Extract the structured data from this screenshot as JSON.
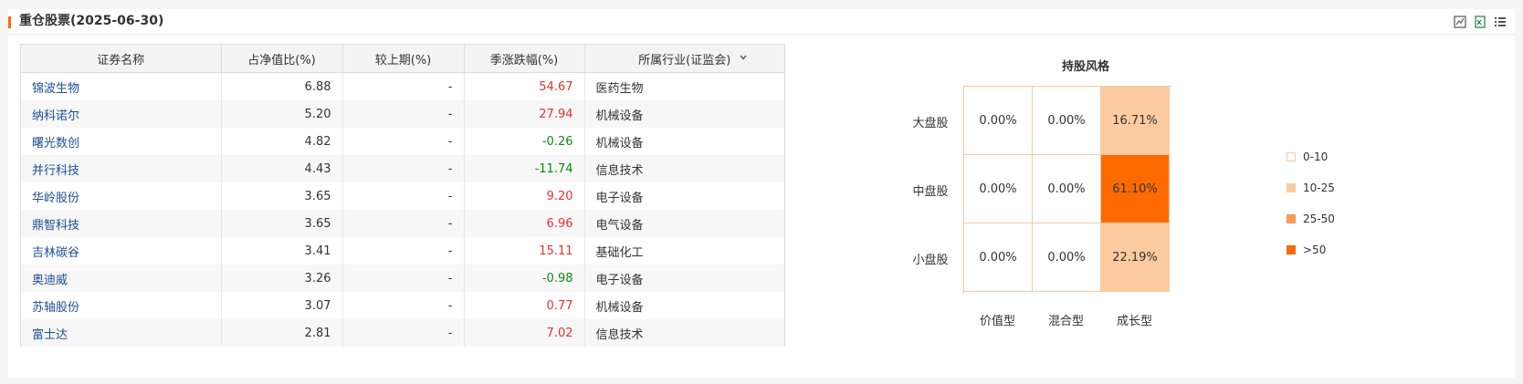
{
  "panel": {
    "title": "重仓股票(2025-06-30)"
  },
  "toolbar": {
    "icons": [
      "chart-export-icon",
      "excel-export-icon",
      "list-view-icon"
    ]
  },
  "table": {
    "columns": [
      "证券名称",
      "占净值比(%)",
      "较上期(%)",
      "季涨跌幅(%)",
      "所属行业(证监会)"
    ],
    "rows": [
      {
        "name": "锦波生物",
        "ratio": "6.88",
        "change": "-",
        "quarter": "54.67",
        "industry": "医药生物",
        "dir": "up"
      },
      {
        "name": "纳科诺尔",
        "ratio": "5.20",
        "change": "-",
        "quarter": "27.94",
        "industry": "机械设备",
        "dir": "up"
      },
      {
        "name": "曙光数创",
        "ratio": "4.82",
        "change": "-",
        "quarter": "-0.26",
        "industry": "机械设备",
        "dir": "down"
      },
      {
        "name": "并行科技",
        "ratio": "4.43",
        "change": "-",
        "quarter": "-11.74",
        "industry": "信息技术",
        "dir": "down"
      },
      {
        "name": "华岭股份",
        "ratio": "3.65",
        "change": "-",
        "quarter": "9.20",
        "industry": "电子设备",
        "dir": "up"
      },
      {
        "name": "鼎智科技",
        "ratio": "3.65",
        "change": "-",
        "quarter": "6.96",
        "industry": "电气设备",
        "dir": "up"
      },
      {
        "name": "吉林碳谷",
        "ratio": "3.41",
        "change": "-",
        "quarter": "15.11",
        "industry": "基础化工",
        "dir": "up"
      },
      {
        "name": "奥迪威",
        "ratio": "3.26",
        "change": "-",
        "quarter": "-0.98",
        "industry": "电子设备",
        "dir": "down"
      },
      {
        "name": "苏轴股份",
        "ratio": "3.07",
        "change": "-",
        "quarter": "0.77",
        "industry": "机械设备",
        "dir": "up"
      },
      {
        "name": "富士达",
        "ratio": "2.81",
        "change": "-",
        "quarter": "7.02",
        "industry": "信息技术",
        "dir": "up"
      }
    ]
  },
  "colors": {
    "up": "#e83131",
    "down": "#0f8a14",
    "accent": "#ff6a00",
    "link": "#1d4e96"
  },
  "chart_data": {
    "type": "heatmap",
    "title": "持股风格",
    "x": [
      "价值型",
      "混合型",
      "成长型"
    ],
    "y": [
      "大盘股",
      "中盘股",
      "小盘股"
    ],
    "values": [
      [
        0.0,
        0.0,
        16.71
      ],
      [
        0.0,
        0.0,
        61.1
      ],
      [
        0.0,
        0.0,
        22.19
      ]
    ],
    "unit": "%",
    "legend": [
      {
        "label": "0-10",
        "color": "#ffffff"
      },
      {
        "label": "10-25",
        "color": "#fccb9f"
      },
      {
        "label": "25-50",
        "color": "#fb9a56"
      },
      {
        "label": ">50",
        "color": "#ff6a00"
      }
    ],
    "legend_position": "right"
  }
}
